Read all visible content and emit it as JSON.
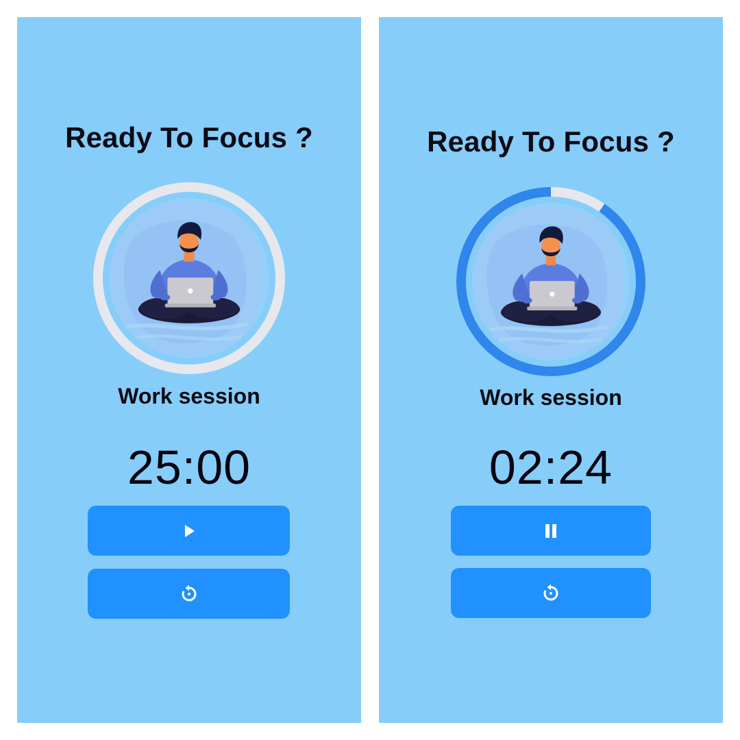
{
  "colors": {
    "panel_bg": "#87cdf9",
    "button_bg": "#2091ff",
    "ring_track": "#e6e8ee",
    "ring_progress": "#2f86eb",
    "text": "#0a0a14"
  },
  "screens": [
    {
      "title": "Ready To Focus ?",
      "session_label": "Work session",
      "timer": "25:00",
      "progress_fraction": 0,
      "primary_icon": "play-icon",
      "secondary_icon": "reset-icon"
    },
    {
      "title": "Ready To Focus ?",
      "session_label": "Work session",
      "timer": "02:24",
      "progress_fraction": 0.904,
      "primary_icon": "pause-icon",
      "secondary_icon": "reset-icon"
    }
  ]
}
